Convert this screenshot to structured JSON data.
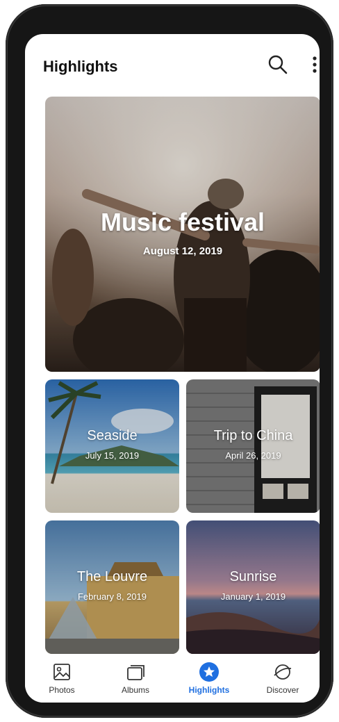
{
  "app": {
    "title": "Highlights"
  },
  "featured": {
    "title": "Music festival",
    "date": "August 12, 2019"
  },
  "cards": [
    {
      "title": "Seaside",
      "date": "July 15, 2019"
    },
    {
      "title": "Trip to China",
      "date": "April 26, 2019"
    },
    {
      "title": "The Louvre",
      "date": "February 8, 2019"
    },
    {
      "title": "Sunrise",
      "date": "January 1, 2019"
    }
  ],
  "nav": {
    "items": [
      {
        "label": "Photos",
        "icon": "image-icon"
      },
      {
        "label": "Albums",
        "icon": "albums-icon"
      },
      {
        "label": "Highlights",
        "icon": "star-icon",
        "active": true
      },
      {
        "label": "Discover",
        "icon": "planet-icon"
      }
    ]
  },
  "colors": {
    "accent": "#1f6fe0",
    "text": "#111111"
  }
}
